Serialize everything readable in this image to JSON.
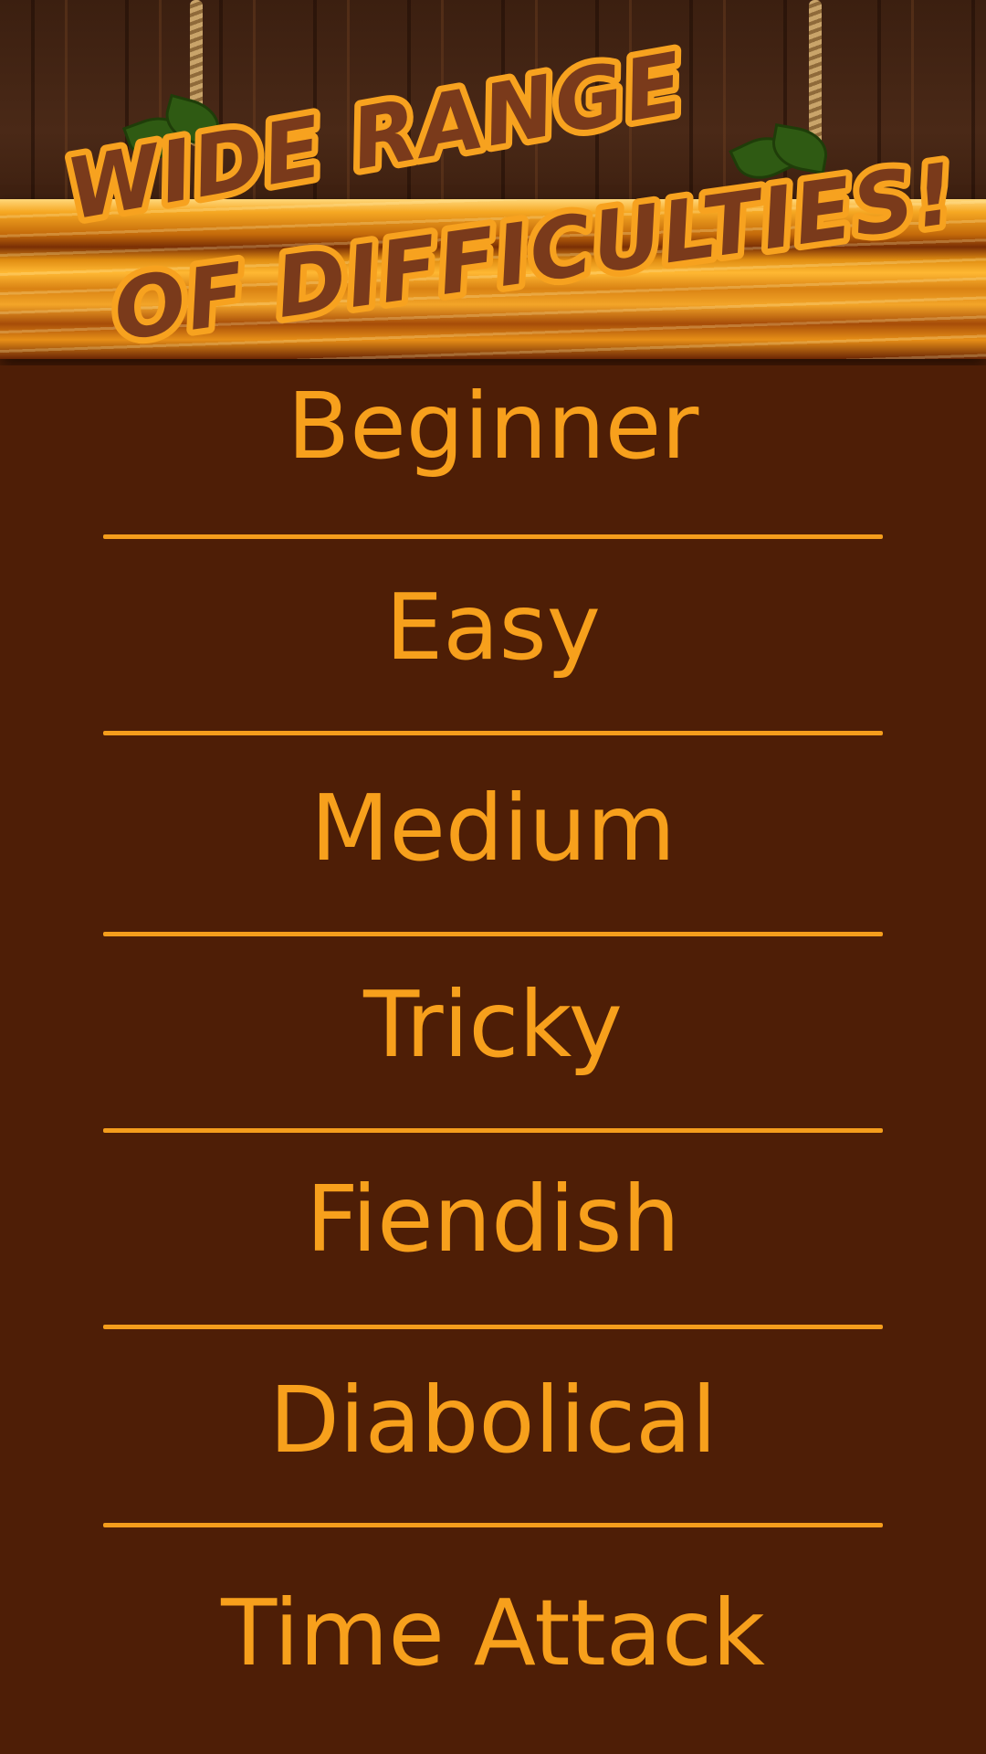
{
  "header": {
    "title_line1": "WIDE RANGE",
    "title_line2": "OF DIFFICULTIES!"
  },
  "menu": {
    "items": [
      {
        "label": "Beginner"
      },
      {
        "label": "Easy"
      },
      {
        "label": "Medium"
      },
      {
        "label": "Tricky"
      },
      {
        "label": "Fiendish"
      },
      {
        "label": "Diabolical"
      },
      {
        "label": "Time Attack"
      }
    ]
  },
  "colors": {
    "background": "#4e1e06",
    "accent": "#f7a01c",
    "title_fill": "#7a3a1b",
    "plank": "#f6a823"
  }
}
